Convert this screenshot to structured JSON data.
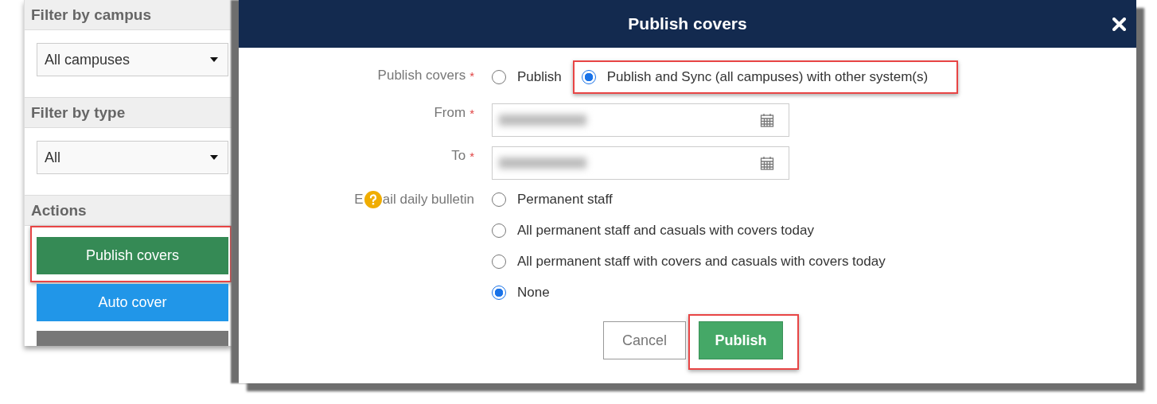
{
  "sidebar": {
    "sections": [
      {
        "title": "Filter by campus",
        "kind": "select",
        "value": "All campuses"
      },
      {
        "title": "Filter by type",
        "kind": "select",
        "value": "All"
      },
      {
        "title": "Actions",
        "kind": "actions",
        "buttons": [
          {
            "label": "Publish covers",
            "color": "#358a55",
            "highlighted": true
          },
          {
            "label": "Auto cover",
            "color": "#2196e8",
            "highlighted": false
          },
          {
            "color": "#777777",
            "highlighted": false
          }
        ]
      }
    ]
  },
  "modal": {
    "title": "Publish covers",
    "publish_mode": {
      "label": "Publish covers",
      "marker": "*",
      "options": [
        {
          "label": "Publish",
          "selected": false,
          "highlighted": false
        },
        {
          "label": "Publish and Sync (all campuses) with other system(s)",
          "selected": true,
          "highlighted": true
        }
      ]
    },
    "from": {
      "label": "From",
      "marker": "*"
    },
    "to": {
      "label": "To",
      "marker": "*"
    },
    "email_bulletin": {
      "label_start": "E",
      "label_end": "ail daily bulletin",
      "options": [
        {
          "label": "Permanent staff",
          "selected": false
        },
        {
          "label": "All permanent staff and casuals with covers today",
          "selected": false
        },
        {
          "label": "All permanent staff with covers and casuals with covers today",
          "selected": false
        },
        {
          "label": "None",
          "selected": true
        }
      ]
    },
    "buttons": [
      {
        "label": "Cancel",
        "kind": "secondary",
        "highlighted": false
      },
      {
        "label": "Publish",
        "kind": "primary",
        "highlighted": true
      }
    ]
  }
}
